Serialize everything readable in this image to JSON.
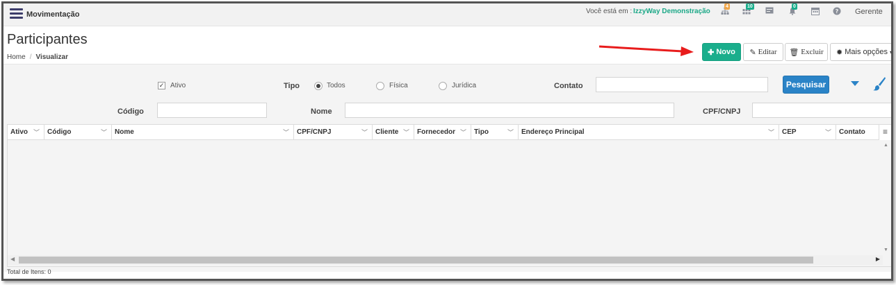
{
  "topbar": {
    "title": "Movimentação",
    "location_label": "Você está em :",
    "location_value": "IzzyWay Demonstração",
    "badge_1": "4",
    "badge_2": "10",
    "badge_3": "0",
    "user": "Gerente",
    "badge_colors": [
      "#f0a64a",
      "#1aae8c",
      "#1aae8c"
    ]
  },
  "page": {
    "title": "Participantes",
    "breadcrumb": [
      "Home",
      "/",
      "Visualizar"
    ]
  },
  "toolbar": {
    "novo": "Novo",
    "editar": "Editar",
    "excluir": "Excluir",
    "mais_opcoes": "Mais opções"
  },
  "filters": {
    "ativo_label": "Ativo",
    "ativo_checked": true,
    "tipo_label": "Tipo",
    "tipo_options": [
      "Todos",
      "Física",
      "Jurídica"
    ],
    "tipo_selected": "Todos",
    "contato_label": "Contato",
    "contato_value": "",
    "codigo_label": "Código",
    "codigo_value": "",
    "nome_label": "Nome",
    "nome_value": "",
    "cpf_label": "CPF/CNPJ",
    "cpf_value": "",
    "search_label": "Pesquisar"
  },
  "grid": {
    "columns": [
      "Ativo",
      "Código",
      "Nome",
      "CPF/CNPJ",
      "Cliente",
      "Fornecedor",
      "Tipo",
      "Endereço Principal",
      "CEP",
      "Contato"
    ],
    "rows": [],
    "total": "Total de Itens: 0"
  },
  "colors": {
    "primary": "#1aae8c",
    "search": "#2a83c7",
    "arrow": "#e81c1c"
  }
}
